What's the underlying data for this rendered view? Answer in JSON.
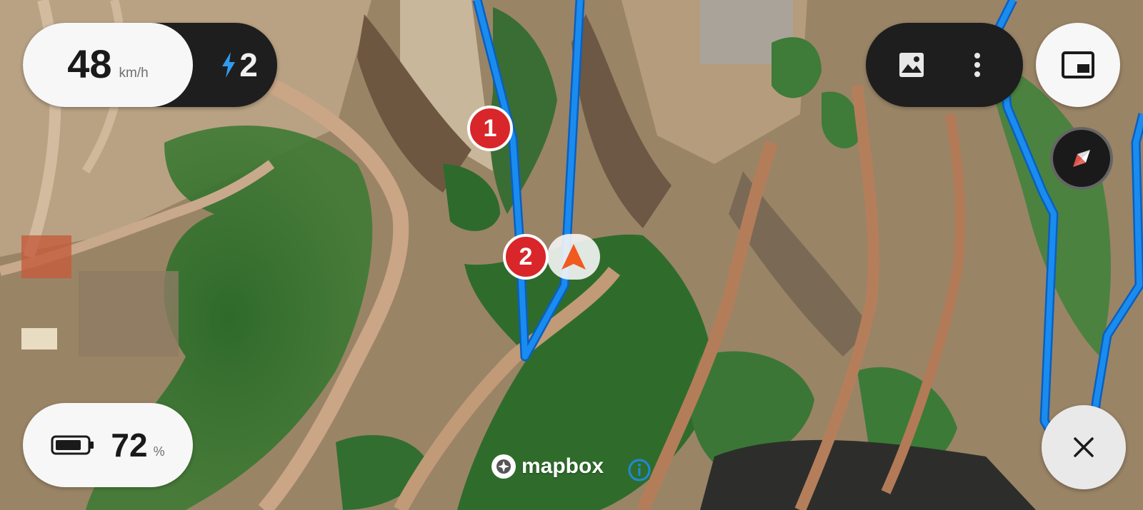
{
  "speed": {
    "value": "48",
    "unit": "km/h"
  },
  "assist": {
    "icon": "lightning-icon",
    "level": "2"
  },
  "battery": {
    "icon": "battery-icon",
    "value": "72",
    "unit": "%",
    "charge_fraction": 0.72
  },
  "toolbar": {
    "map_style_icon": "image-icon",
    "more_icon": "more-vertical-icon"
  },
  "pip_icon": "picture-in-picture-icon",
  "compass_icon": "compass-icon",
  "close_icon": "close-icon",
  "waypoints": [
    {
      "label": "1"
    },
    {
      "label": "2"
    }
  ],
  "location_icon": "navigation-arrow-icon",
  "attribution": {
    "logo": "mapbox-logo",
    "text": "mapbox",
    "info_icon": "info-icon"
  },
  "colors": {
    "route": "#1a8cf0",
    "waypoint": "#d8262a",
    "location": "#f05a1e",
    "pill_dark": "#1e1e1e",
    "pill_light": "#f7f7f7"
  }
}
